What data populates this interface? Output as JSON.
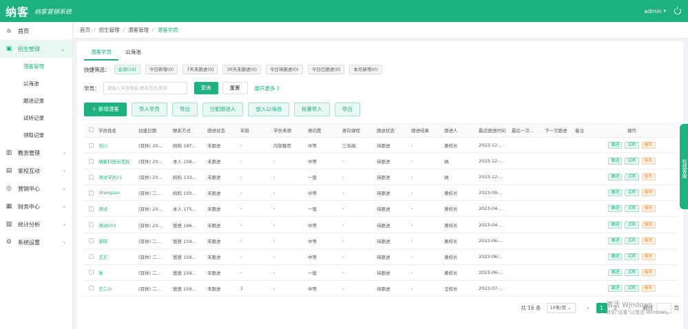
{
  "header": {
    "logo": "纳客",
    "slogan": "纳客营销系统",
    "user": "admin",
    "caret": "▾"
  },
  "sidebar": {
    "items": [
      {
        "label": "首页",
        "icon": "home-icon",
        "glyph": "⌂"
      },
      {
        "label": "招生管理",
        "icon": "enroll-icon",
        "glyph": "▣",
        "arrow": "⌄"
      },
      {
        "label": "教务管理",
        "icon": "teach-icon",
        "glyph": "▥",
        "arrow": "›"
      },
      {
        "label": "家校互动",
        "icon": "chat-icon",
        "glyph": "▤",
        "arrow": "›"
      },
      {
        "label": "营销中心",
        "icon": "market-icon",
        "glyph": "◎",
        "arrow": "›"
      },
      {
        "label": "财务中心",
        "icon": "finance-icon",
        "glyph": "▦",
        "arrow": "›"
      },
      {
        "label": "统计分析",
        "icon": "stats-icon",
        "glyph": "▧",
        "arrow": "›"
      },
      {
        "label": "系统设置",
        "icon": "settings-icon",
        "glyph": "⚙",
        "arrow": "›"
      }
    ],
    "subitems": [
      "潜客管理",
      "公海池",
      "跟进记录",
      "试听记录",
      "领取记录"
    ]
  },
  "breadcrumb": [
    "首页",
    "招生管理",
    "潜客管理",
    "潜客学员"
  ],
  "tabs": [
    "潜客学员",
    "公海池"
  ],
  "quick_filter": {
    "label": "快捷筛选：",
    "chips": [
      "全部(16)",
      "今日新增(0)",
      "7天未跟进(0)",
      "30天未跟进(0)",
      "今日待跟进(0)",
      "今日已跟进(0)",
      "本月新增(0)"
    ]
  },
  "search": {
    "label": "学员：",
    "placeholder": "请输入学员姓名/联系方式查询",
    "query": "查询",
    "reset": "重置",
    "expand": "展开更多 》"
  },
  "actions": [
    "＋ 新增潜客",
    "导入学员",
    "导出",
    "分配跟进人",
    "放入公海池",
    "批量导入",
    "导出"
  ],
  "table": {
    "headers": [
      "学员姓名",
      "创建日期",
      "联系方式",
      "跟进状态",
      "年龄",
      "学员来源",
      "意向度",
      "意向课程",
      "跟进状态",
      "跟进结果",
      "跟进人",
      "最近跟进时间",
      "最后一次...",
      "下一次跟进",
      "备注",
      "操作"
    ],
    "rows": [
      [
        "马川",
        "(双休) 20...",
        "妈妈 187...",
        "未跟进",
        "-",
        "内部推荐",
        "中等",
        "三年级",
        "待跟进",
        "-",
        "黄校长",
        "2023-12-...",
        "",
        "",
        ""
      ],
      [
        "纳客科技示范校",
        "(双休) 20...",
        "本人 158...",
        "未跟进",
        "-",
        "-",
        "中等",
        "-",
        "待跟进",
        "-",
        "纳",
        "2023-12-...",
        "",
        "",
        ""
      ],
      [
        "测试学员01",
        "(双休) 20...",
        "妈妈 133...",
        "未跟进",
        "-",
        "-",
        "一般",
        "-",
        "待跟进",
        "-",
        "纳",
        "2023-12-...",
        "",
        "",
        ""
      ],
      [
        "zhangsan",
        "(双休) 二...",
        "妈妈 150...",
        "未跟进",
        "-",
        "-",
        "中等",
        "-",
        "待跟进",
        "-",
        "黄校长",
        "2023-09-...",
        "",
        "",
        ""
      ],
      [
        "测试",
        "(双休) 20...",
        "本人 175...",
        "未跟进",
        "-",
        "-",
        "一般",
        "-",
        "待跟进",
        "-",
        "黄校长",
        "2023-04-...",
        "",
        "",
        ""
      ],
      [
        "测试003",
        "(双休) 20...",
        "爸爸 186...",
        "未跟进",
        "-",
        "-",
        "中等",
        "-",
        "待跟进",
        "-",
        "黄校长",
        "2023-04-...",
        "",
        "",
        ""
      ],
      [
        "李四",
        "(双休) 二...",
        "爸爸 159...",
        "未跟进",
        "-",
        "-",
        "中等",
        "-",
        "待跟进",
        "-",
        "黄校长",
        "2023-06-...",
        "",
        "",
        ""
      ],
      [
        "王五",
        "(双休) 二...",
        "爸爸 159...",
        "未跟进",
        "-",
        "-",
        "中等",
        "-",
        "待跟进",
        "-",
        "黄校长",
        "2023-06-...",
        "",
        "",
        ""
      ],
      [
        "张",
        "(双休) 二...",
        "爸爸 159...",
        "未跟进",
        "-",
        "-",
        "一般",
        "-",
        "待跟进",
        "-",
        "黄校长",
        "2023-06-...",
        "",
        "",
        ""
      ],
      [
        "王二小",
        "(双休) 二...",
        "爸爸 159...",
        "未跟进",
        "1",
        "-",
        "中等",
        "-",
        "待跟进",
        "-",
        "王校长",
        "2023-07-...",
        "",
        "",
        ""
      ]
    ],
    "ops": [
      "跟进",
      "试听",
      "报名"
    ]
  },
  "pager": {
    "total": "共 16 条",
    "size": "10条/页 ⌄",
    "prev": "‹",
    "pages": [
      "1",
      "2"
    ],
    "next": "›",
    "goto": "前往",
    "unit": "页"
  },
  "watermark": {
    "title": "激活 Windows",
    "sub": "转到\"设置\"以激活 Windows。"
  },
  "float_tab": "在线客服"
}
